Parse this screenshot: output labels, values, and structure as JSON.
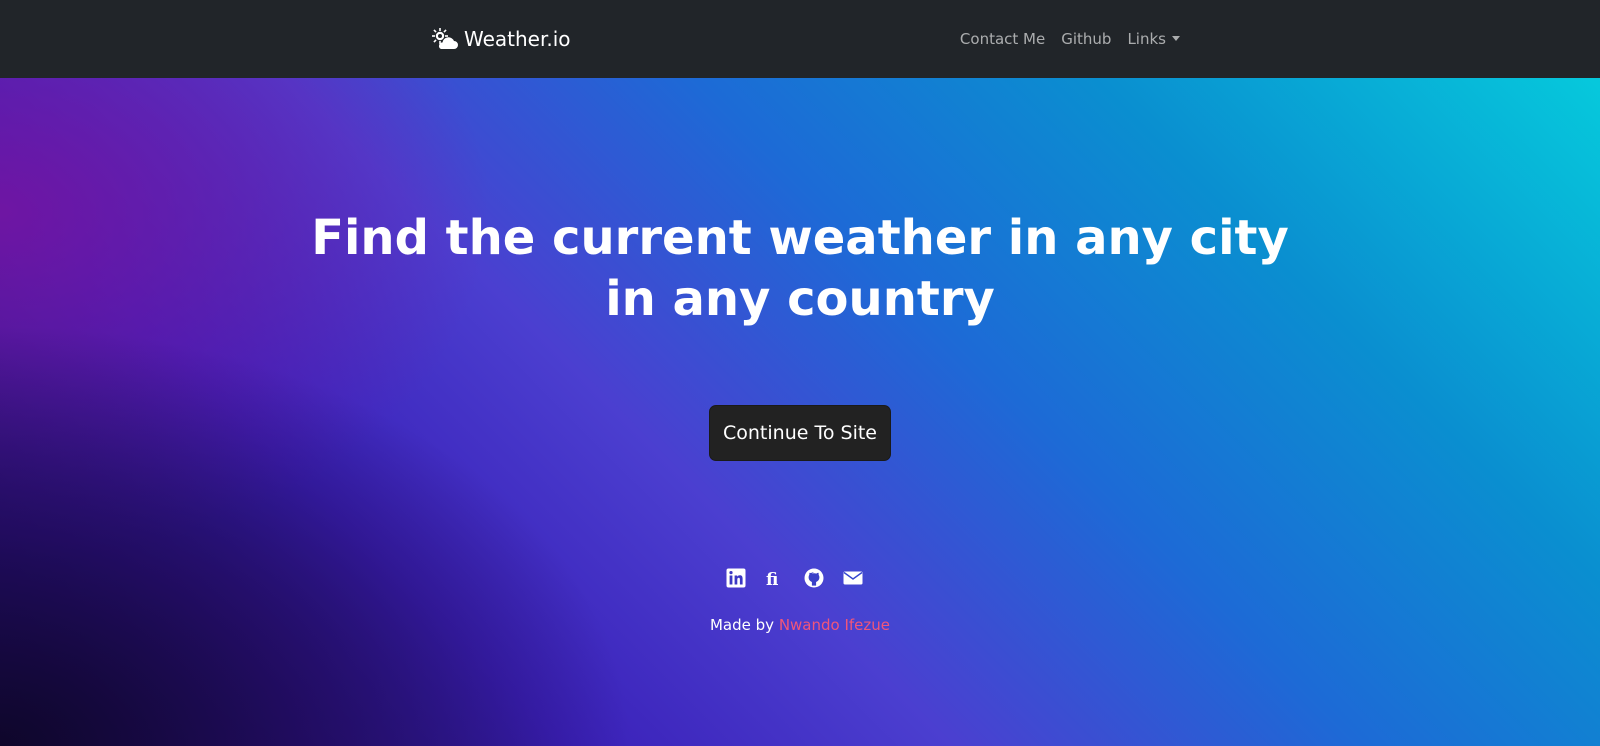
{
  "navbar": {
    "brand_label": "Weather.io",
    "brand_icon": "cloud-sun-icon",
    "links": [
      {
        "label": "Contact Me"
      },
      {
        "label": "Github"
      },
      {
        "label": "Links",
        "icon": "chevron-down-icon"
      }
    ]
  },
  "hero": {
    "title": "Find the current weather in any city in any country",
    "cta_label": "Continue To Site",
    "socials": [
      {
        "icon": "linkedin-icon"
      },
      {
        "icon": "fi-icon"
      },
      {
        "icon": "github-icon"
      },
      {
        "icon": "envelope-icon"
      }
    ],
    "credit_prefix": "Made by",
    "credit_author": "Nwando Ifezue"
  },
  "colors": {
    "navbar_bg": "#212529",
    "button_bg": "#222222",
    "author_link": "#f0567a"
  }
}
